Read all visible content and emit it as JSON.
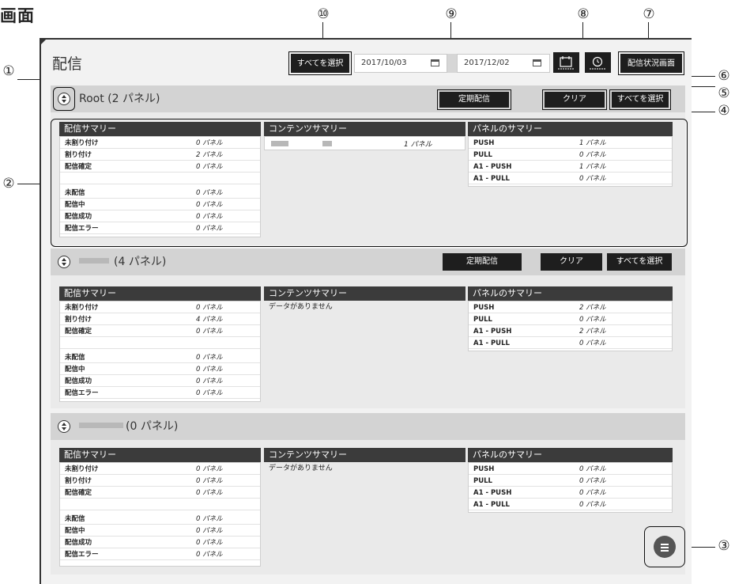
{
  "page_heading": "画面",
  "callouts": [
    "①",
    "②",
    "③",
    "④",
    "⑤",
    "⑥",
    "⑦",
    "⑧",
    "⑨",
    "⑩"
  ],
  "app": {
    "title": "配信",
    "toolbar": {
      "select_all": "すべてを選択",
      "start_date": "2017/10/03",
      "end_date": "2017/12/02",
      "status_screen": "配信状況画面"
    }
  },
  "labels": {
    "scheduled": "定期配信",
    "clear": "クリア",
    "select_all": "すべてを選択",
    "delivery_summary": "配信サマリー",
    "content_summary": "コンテンツサマリー",
    "panel_summary": "パネルのサマリー",
    "no_data": "データがありません"
  },
  "sections": [
    {
      "name": "Root",
      "count": "(2 パネル)",
      "delivery": [
        {
          "k": "未割り付け",
          "v": "0 パネル"
        },
        {
          "k": "割り付け",
          "v": "2 パネル"
        },
        {
          "k": "配信確定",
          "v": "0 パネル"
        },
        {
          "k": "",
          "v": ""
        },
        {
          "k": "未配信",
          "v": "0 パネル"
        },
        {
          "k": "配信中",
          "v": "0 パネル"
        },
        {
          "k": "配信成功",
          "v": "0 パネル"
        },
        {
          "k": "配信エラー",
          "v": "0 パネル"
        }
      ],
      "content": [
        {
          "v": "1 パネル"
        }
      ],
      "panels": [
        {
          "k": "PUSH",
          "v": "1 パネル"
        },
        {
          "k": "PULL",
          "v": "0 パネル"
        },
        {
          "k": "A1 - PUSH",
          "v": "1 パネル"
        },
        {
          "k": "A1 - PULL",
          "v": "0 パネル"
        }
      ]
    },
    {
      "name": "",
      "count": "(4 パネル)",
      "delivery": [
        {
          "k": "未割り付け",
          "v": "0 パネル"
        },
        {
          "k": "割り付け",
          "v": "4 パネル"
        },
        {
          "k": "配信確定",
          "v": "0 パネル"
        },
        {
          "k": "",
          "v": ""
        },
        {
          "k": "未配信",
          "v": "0 パネル"
        },
        {
          "k": "配信中",
          "v": "0 パネル"
        },
        {
          "k": "配信成功",
          "v": "0 パネル"
        },
        {
          "k": "配信エラー",
          "v": "0 パネル"
        }
      ],
      "panels": [
        {
          "k": "PUSH",
          "v": "2 パネル"
        },
        {
          "k": "PULL",
          "v": "0 パネル"
        },
        {
          "k": "A1 - PUSH",
          "v": "2 パネル"
        },
        {
          "k": "A1 - PULL",
          "v": "0 パネル"
        }
      ]
    },
    {
      "name": "",
      "count": "(0 パネル)",
      "delivery": [
        {
          "k": "未割り付け",
          "v": "0 パネル"
        },
        {
          "k": "割り付け",
          "v": "0 パネル"
        },
        {
          "k": "配信確定",
          "v": "0 パネル"
        },
        {
          "k": "",
          "v": ""
        },
        {
          "k": "未配信",
          "v": "0 パネル"
        },
        {
          "k": "配信中",
          "v": "0 パネル"
        },
        {
          "k": "配信成功",
          "v": "0 パネル"
        },
        {
          "k": "配信エラー",
          "v": "0 パネル"
        }
      ],
      "panels": [
        {
          "k": "PUSH",
          "v": "0 パネル"
        },
        {
          "k": "PULL",
          "v": "0 パネル"
        },
        {
          "k": "A1 - PUSH",
          "v": "0 パネル"
        },
        {
          "k": "A1 - PULL",
          "v": "0 パネル"
        }
      ]
    }
  ]
}
